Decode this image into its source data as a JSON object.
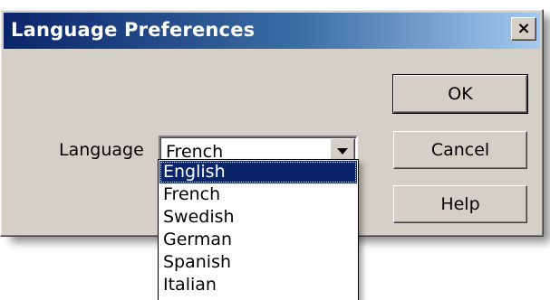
{
  "window": {
    "title": "Language Preferences",
    "close_glyph": "×"
  },
  "form": {
    "language_label": "Language",
    "language_value": "French",
    "options": [
      "English",
      "French",
      "Swedish",
      "German",
      "Spanish",
      "Italian"
    ],
    "highlighted_option": "English"
  },
  "buttons": {
    "ok": "OK",
    "cancel": "Cancel",
    "help": "Help"
  },
  "colors": {
    "titlebar_start": "#0a246a",
    "titlebar_end": "#a6caf0",
    "face": "#d4d0c8",
    "highlight": "#0a246a"
  },
  "icons": {
    "close": "close-icon",
    "dropdown": "chevron-down-icon"
  }
}
